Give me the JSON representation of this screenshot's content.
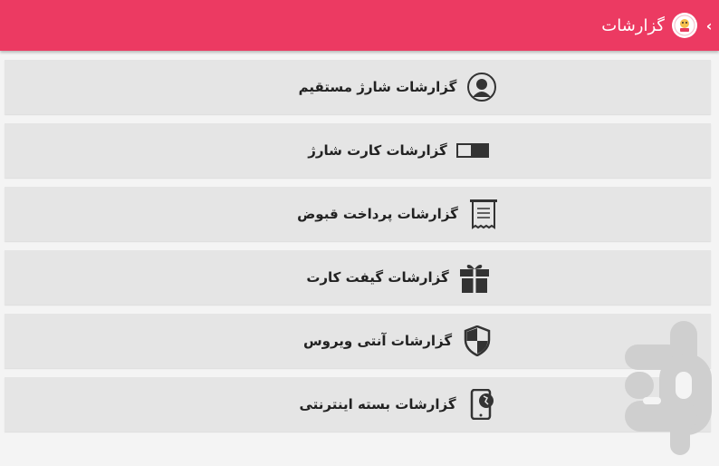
{
  "header": {
    "title": "گزارشات",
    "back_symbol": "‹",
    "background": "#ec3a62"
  },
  "menu": {
    "items": [
      {
        "label": "گزارشات شارژ مستقیم",
        "icon": "user-circle-icon"
      },
      {
        "label": "گزارشات کارت شارژ",
        "icon": "charge-card-icon"
      },
      {
        "label": "گزارشات پرداخت قبوض",
        "icon": "receipt-icon"
      },
      {
        "label": "گزارشات گیفت کارت",
        "icon": "gift-icon"
      },
      {
        "label": "گزارشات آنتی ویروس",
        "icon": "shield-icon"
      },
      {
        "label": "گزارشات بسته اینترنتی",
        "icon": "mobile-internet-icon"
      }
    ]
  },
  "watermark": {
    "name": "app-store-logo",
    "color": "#cfcfcf"
  }
}
